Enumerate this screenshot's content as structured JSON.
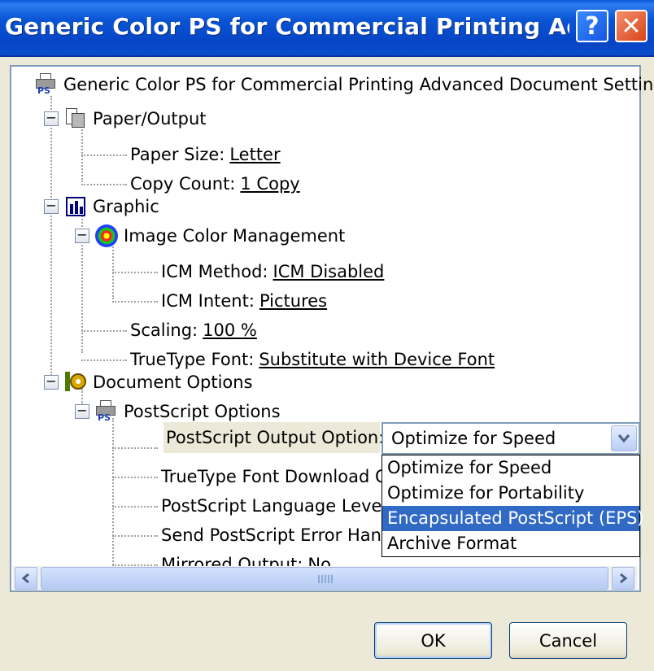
{
  "window": {
    "title": "Generic Color PS for Commercial Printing Advanced ...",
    "help_glyph": "?",
    "close_glyph": "✕"
  },
  "tree": {
    "root": "Generic Color PS for Commercial Printing Advanced Document Settings",
    "paper_output": {
      "label": "Paper/Output",
      "paper_size_label": "Paper Size:",
      "paper_size_value": "Letter",
      "copy_count_label": "Copy Count:",
      "copy_count_value": "1 Copy"
    },
    "graphic": {
      "label": "Graphic",
      "icm": {
        "label": "Image Color Management",
        "method_label": "ICM Method:",
        "method_value": "ICM Disabled",
        "intent_label": "ICM Intent:",
        "intent_value": "Pictures"
      },
      "scaling_label": "Scaling:",
      "scaling_value": "100 %",
      "truetype_label": "TrueType Font:",
      "truetype_value": "Substitute with Device Font"
    },
    "document_options": {
      "label": "Document Options",
      "postscript": {
        "label": "PostScript Options",
        "output_option_label": "PostScript Output Option:",
        "output_option_value": "Optimize for Speed",
        "tt_download_label": "TrueType Font Download Op",
        "language_level_label": "PostScript Language Level: ",
        "error_handler_label": "Send PostScript Error Handle",
        "mirrored_label": "Mirrored Output:",
        "mirrored_value": "No"
      }
    }
  },
  "dropdown": {
    "options": [
      "Optimize for Speed",
      "Optimize for Portability",
      "Encapsulated PostScript (EPS)",
      "Archive Format"
    ],
    "highlighted_index": 2
  },
  "buttons": {
    "ok": "OK",
    "cancel": "Cancel"
  },
  "colors": {
    "titlebar": "#0a55d4",
    "selection": "#316ac5"
  }
}
